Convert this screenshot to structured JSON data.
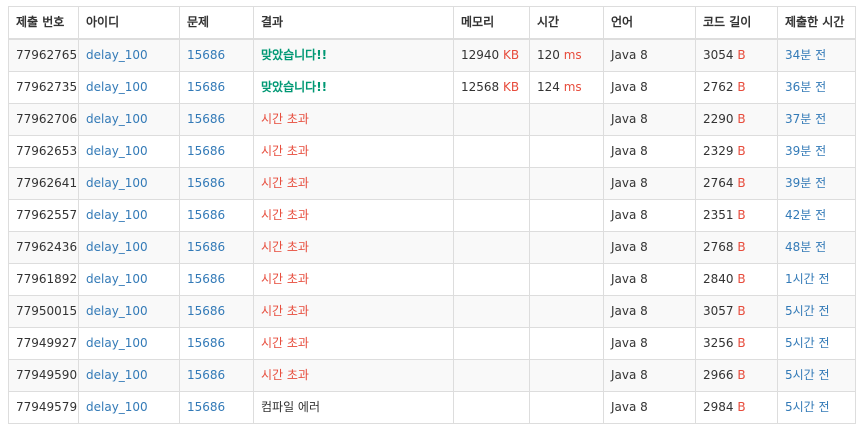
{
  "table": {
    "headers": {
      "solution_id": "제출 번호",
      "user": "아이디",
      "problem": "문제",
      "result": "결과",
      "memory": "메모리",
      "time": "시간",
      "language": "언어",
      "code_length": "코드 길이",
      "submitted": "제출한 시간"
    },
    "units": {
      "memory": "KB",
      "time": "ms",
      "code_length": "B"
    },
    "result_colors": {
      "accepted": "#009874",
      "time_limit": "#e74c3c",
      "compile_error": "#333333"
    },
    "rows": [
      {
        "solution_id": "77962765",
        "user": "delay_100",
        "problem": "15686",
        "result": "맞았습니다!!",
        "result_type": "accepted",
        "memory": "12940",
        "time": "120",
        "language": "Java 8",
        "code_length": "3054",
        "submitted": "34분 전"
      },
      {
        "solution_id": "77962735",
        "user": "delay_100",
        "problem": "15686",
        "result": "맞았습니다!!",
        "result_type": "accepted",
        "memory": "12568",
        "time": "124",
        "language": "Java 8",
        "code_length": "2762",
        "submitted": "36분 전"
      },
      {
        "solution_id": "77962706",
        "user": "delay_100",
        "problem": "15686",
        "result": "시간 초과",
        "result_type": "time_limit",
        "memory": "",
        "time": "",
        "language": "Java 8",
        "code_length": "2290",
        "submitted": "37분 전"
      },
      {
        "solution_id": "77962653",
        "user": "delay_100",
        "problem": "15686",
        "result": "시간 초과",
        "result_type": "time_limit",
        "memory": "",
        "time": "",
        "language": "Java 8",
        "code_length": "2329",
        "submitted": "39분 전"
      },
      {
        "solution_id": "77962641",
        "user": "delay_100",
        "problem": "15686",
        "result": "시간 초과",
        "result_type": "time_limit",
        "memory": "",
        "time": "",
        "language": "Java 8",
        "code_length": "2764",
        "submitted": "39분 전"
      },
      {
        "solution_id": "77962557",
        "user": "delay_100",
        "problem": "15686",
        "result": "시간 초과",
        "result_type": "time_limit",
        "memory": "",
        "time": "",
        "language": "Java 8",
        "code_length": "2351",
        "submitted": "42분 전"
      },
      {
        "solution_id": "77962436",
        "user": "delay_100",
        "problem": "15686",
        "result": "시간 초과",
        "result_type": "time_limit",
        "memory": "",
        "time": "",
        "language": "Java 8",
        "code_length": "2768",
        "submitted": "48분 전"
      },
      {
        "solution_id": "77961892",
        "user": "delay_100",
        "problem": "15686",
        "result": "시간 초과",
        "result_type": "time_limit",
        "memory": "",
        "time": "",
        "language": "Java 8",
        "code_length": "2840",
        "submitted": "1시간 전"
      },
      {
        "solution_id": "77950015",
        "user": "delay_100",
        "problem": "15686",
        "result": "시간 초과",
        "result_type": "time_limit",
        "memory": "",
        "time": "",
        "language": "Java 8",
        "code_length": "3057",
        "submitted": "5시간 전"
      },
      {
        "solution_id": "77949927",
        "user": "delay_100",
        "problem": "15686",
        "result": "시간 초과",
        "result_type": "time_limit",
        "memory": "",
        "time": "",
        "language": "Java 8",
        "code_length": "3256",
        "submitted": "5시간 전"
      },
      {
        "solution_id": "77949590",
        "user": "delay_100",
        "problem": "15686",
        "result": "시간 초과",
        "result_type": "time_limit",
        "memory": "",
        "time": "",
        "language": "Java 8",
        "code_length": "2966",
        "submitted": "5시간 전"
      },
      {
        "solution_id": "77949579",
        "user": "delay_100",
        "problem": "15686",
        "result": "컴파일 에러",
        "result_type": "compile_error",
        "memory": "",
        "time": "",
        "language": "Java 8",
        "code_length": "2984",
        "submitted": "5시간 전"
      }
    ]
  }
}
